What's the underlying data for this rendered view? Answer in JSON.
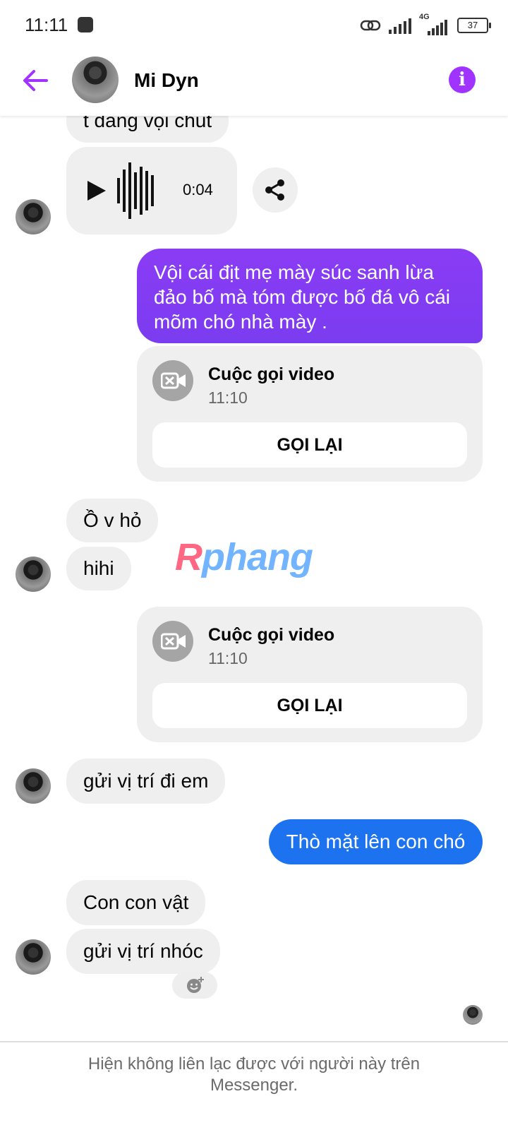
{
  "status_bar": {
    "time": "11:11",
    "battery": "37",
    "network": "4G"
  },
  "header": {
    "contact_name": "Mi Dyn"
  },
  "messages": {
    "m1": "t đang vội chut",
    "voice_duration": "0:04",
    "m2": "Vội cái địt mẹ mày súc sanh lừa đảo bố mà tóm được bố đá vô cái mõm chó nhà mày .",
    "call1": {
      "title": "Cuộc gọi video",
      "time": "11:10",
      "button": "GỌI LẠI"
    },
    "m3": "Ồ v hỏ",
    "m4": "hihi",
    "call2": {
      "title": "Cuộc gọi video",
      "time": "11:10",
      "button": "GỌI LẠI"
    },
    "m5": "gửi vị trí đi em",
    "m6": "Thò mặt lên con chó",
    "m7": "Con con vật",
    "m8": "gửi vị trí nhóc"
  },
  "watermark": {
    "first": "R",
    "rest": "phang"
  },
  "footer": {
    "text": "Hiện không liên lạc được với người này trên Messenger."
  },
  "colors": {
    "accent": "#a033ff",
    "outgoing_purple": "#7b3cf0",
    "outgoing_blue": "#1d72f0",
    "incoming": "#efefef"
  }
}
